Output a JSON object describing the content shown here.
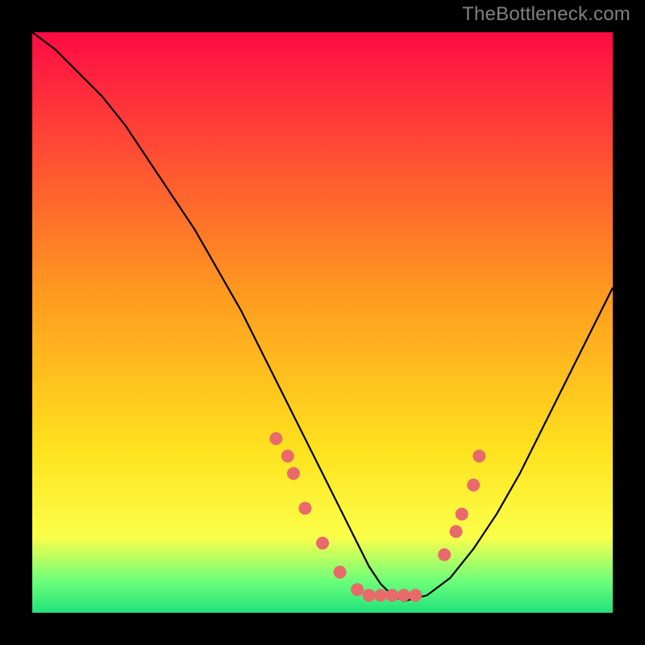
{
  "watermark": "TheBottleneck.com",
  "chart_data": {
    "type": "line",
    "title": "",
    "xlabel": "",
    "ylabel": "",
    "xlim": [
      0,
      100
    ],
    "ylim": [
      0,
      100
    ],
    "background_gradient": {
      "direction": "vertical",
      "stops": [
        {
          "pos": 0.0,
          "color": "#ff0b45"
        },
        {
          "pos": 0.45,
          "color": "#ff9a1f"
        },
        {
          "pos": 0.72,
          "color": "#ffe21e"
        },
        {
          "pos": 0.87,
          "color": "#fbff4a"
        },
        {
          "pos": 0.945,
          "color": "#6dff7a"
        },
        {
          "pos": 1.0,
          "color": "#22e27b"
        }
      ]
    },
    "series": [
      {
        "name": "bottleneck-curve",
        "color": "#000000",
        "x": [
          0,
          4,
          8,
          12,
          16,
          20,
          24,
          28,
          32,
          36,
          40,
          44,
          48,
          52,
          56,
          58,
          60,
          62,
          64,
          68,
          72,
          76,
          80,
          84,
          88,
          92,
          96,
          100
        ],
        "y": [
          100,
          97,
          93,
          89,
          84,
          78,
          72,
          66,
          59,
          52,
          44,
          36,
          28,
          20,
          12,
          8,
          5,
          3,
          2,
          3,
          6,
          11,
          17,
          24,
          32,
          40,
          48,
          56
        ]
      },
      {
        "name": "highlight-points",
        "type": "scatter",
        "color": "#e96a6a",
        "x": [
          42,
          44,
          45,
          47,
          50,
          53,
          56,
          58,
          60,
          62,
          64,
          66,
          71,
          73,
          74,
          76,
          77
        ],
        "y": [
          30,
          27,
          24,
          18,
          12,
          7,
          4,
          3,
          3,
          3,
          3,
          3,
          10,
          14,
          17,
          22,
          27
        ]
      }
    ]
  }
}
